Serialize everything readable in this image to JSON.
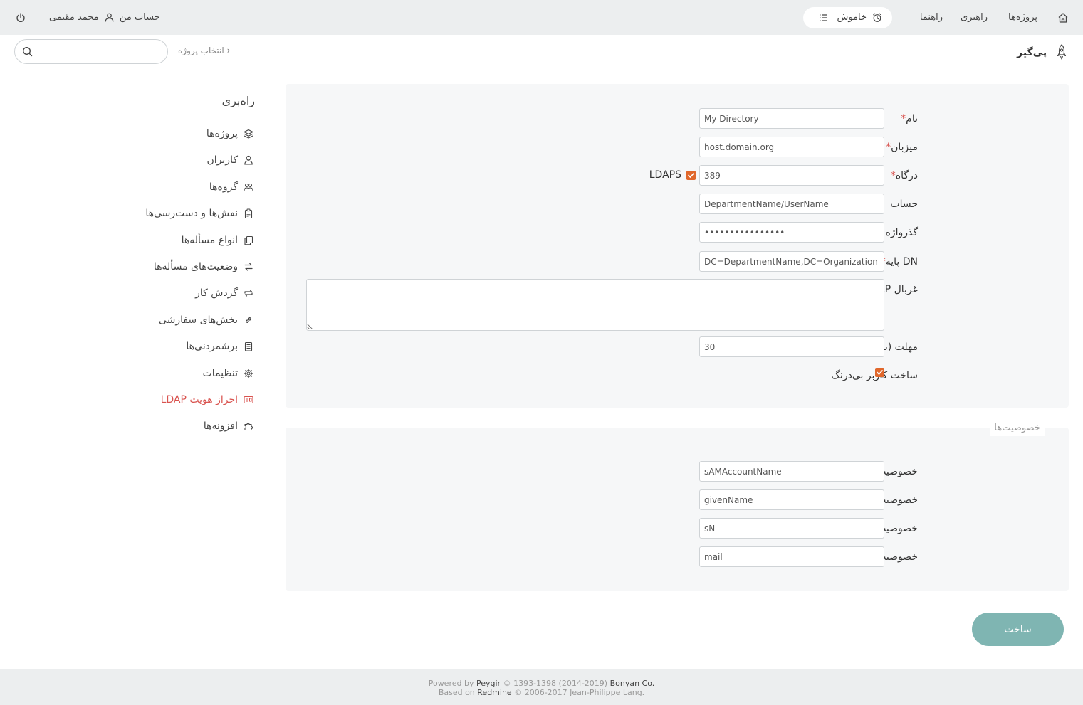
{
  "topnav": {
    "projects": "پروژه‌ها",
    "admin": "راهبری",
    "help": "راهنما",
    "alarm": "خاموش",
    "user_name": "محمد مقیمی",
    "my_account": "حساب من"
  },
  "header": {
    "brand": "پی‌گیر",
    "project_select": "انتخاب پروژه",
    "search_placeholder": ""
  },
  "sidebar": {
    "title": "راه‌بری",
    "items": [
      {
        "label": "پروژه‌ها",
        "icon": "layers-icon"
      },
      {
        "label": "کاربران",
        "icon": "user-icon"
      },
      {
        "label": "گروه‌ها",
        "icon": "group-icon"
      },
      {
        "label": "نقش‌ها و دست‌رسی‌ها",
        "icon": "clipboard-icon"
      },
      {
        "label": "انواع مسأله‌ها",
        "icon": "copy-icon"
      },
      {
        "label": "وضعیت‌های مسأله‌ها",
        "icon": "swap-icon"
      },
      {
        "label": "گردش کار",
        "icon": "repeat-icon"
      },
      {
        "label": "بخش‌های سفارشی",
        "icon": "link-icon"
      },
      {
        "label": "برشمردنی‌ها",
        "icon": "list-icon"
      },
      {
        "label": "تنظیمات",
        "icon": "gear-icon"
      },
      {
        "label": "احراز هویت LDAP",
        "icon": "id-card-icon",
        "active": true
      },
      {
        "label": "افزونه‌ها",
        "icon": "puzzle-icon"
      }
    ]
  },
  "form": {
    "name_label": "نام",
    "name_value": "My Directory",
    "host_label": "میزبان",
    "host_value": "host.domain.org",
    "port_label": "درگاه",
    "port_value": "389",
    "ldaps_label": "LDAPS",
    "account_label": "حساب",
    "account_value": "DepartmentName/UserName",
    "password_label": "گذرواژه",
    "password_value": "passwordpassword",
    "base_dn_label": "DN پایه",
    "base_dn_value": "DC=DepartmentName,DC=OrganizationName",
    "filter_label": "غربال LDAP",
    "filter_value": "",
    "timeout_label": "مهلت (به ثانیه)",
    "timeout_value": "30",
    "onthefly_label": "ساخت کاربر بی‌درنگ",
    "required_mark": "*"
  },
  "attributes": {
    "legend": "خصوصیت‌ها",
    "login_label": "خصوصیت ورود",
    "login_value": "sAMAccountName",
    "firstname_label": "خصوصیت نام کوچک",
    "firstname_value": "givenName",
    "lastname_label": "خصوصیت نام خانوادگی",
    "lastname_value": "sN",
    "mail_label": "خصوصیت رایانامه",
    "mail_value": "mail"
  },
  "submit_label": "ساخت",
  "footer": {
    "line1_prefix": "Powered by",
    "line1_link": "Peygir",
    "line1_mid": "© 1393-1398 (2014-2019)",
    "line1_company": "Bonyan Co.",
    "line2_prefix": "Based on",
    "line2_link": "Redmine",
    "line2_suffix": "© 2006-2017 Jean-Philippe Lang."
  },
  "colors": {
    "accent_red": "#d9534f",
    "checkbox": "#e0672b",
    "submit": "#7fb5b2",
    "bar_bg": "#eceeef"
  }
}
